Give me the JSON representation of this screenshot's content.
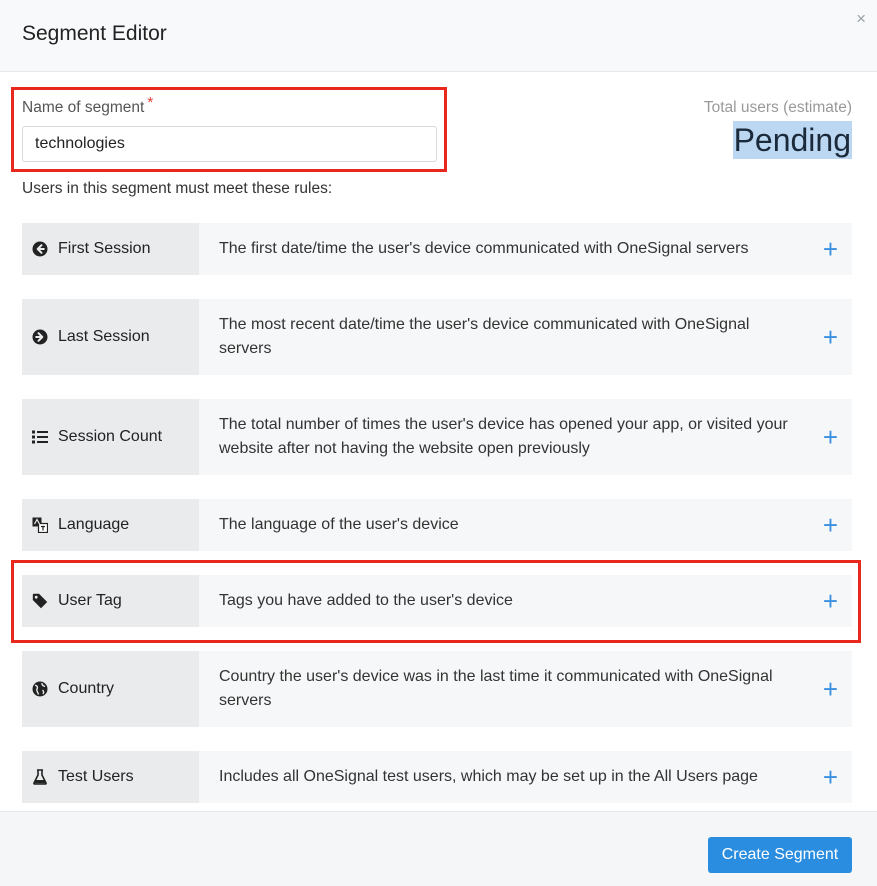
{
  "modal": {
    "title": "Segment Editor",
    "close_glyph": "×"
  },
  "form": {
    "name_label": "Name of segment",
    "required_marker": "*",
    "name_value": "technologies"
  },
  "estimate": {
    "label": "Total users (estimate)",
    "value": "Pending"
  },
  "rules_intro": "Users in this segment must meet these rules:",
  "rules": [
    {
      "name": "First Session",
      "icon": "arrow-circle-left-icon",
      "description": "The first date/time the user's device communicated with OneSignal servers"
    },
    {
      "name": "Last Session",
      "icon": "arrow-circle-right-icon",
      "description": "The most recent date/time the user's device communicated with OneSignal servers"
    },
    {
      "name": "Session Count",
      "icon": "list-icon",
      "description": "The total number of times the user's device has opened your app, or visited your website after not having the website open previously"
    },
    {
      "name": "Language",
      "icon": "language-icon",
      "description": "The language of the user's device"
    },
    {
      "name": "User Tag",
      "icon": "tag-icon",
      "description": "Tags you have added to the user's device"
    },
    {
      "name": "Country",
      "icon": "globe-icon",
      "description": "Country the user's device was in the last time it communicated with OneSignal servers"
    },
    {
      "name": "Test Users",
      "icon": "flask-icon",
      "description": "Includes all OneSignal test users, which may be set up in the All Users page"
    }
  ],
  "plus_glyph": "+",
  "footer": {
    "create_label": "Create Segment"
  },
  "colors": {
    "accent": "#2b8de0",
    "highlight": "#e8281c",
    "required": "#e03c31"
  }
}
